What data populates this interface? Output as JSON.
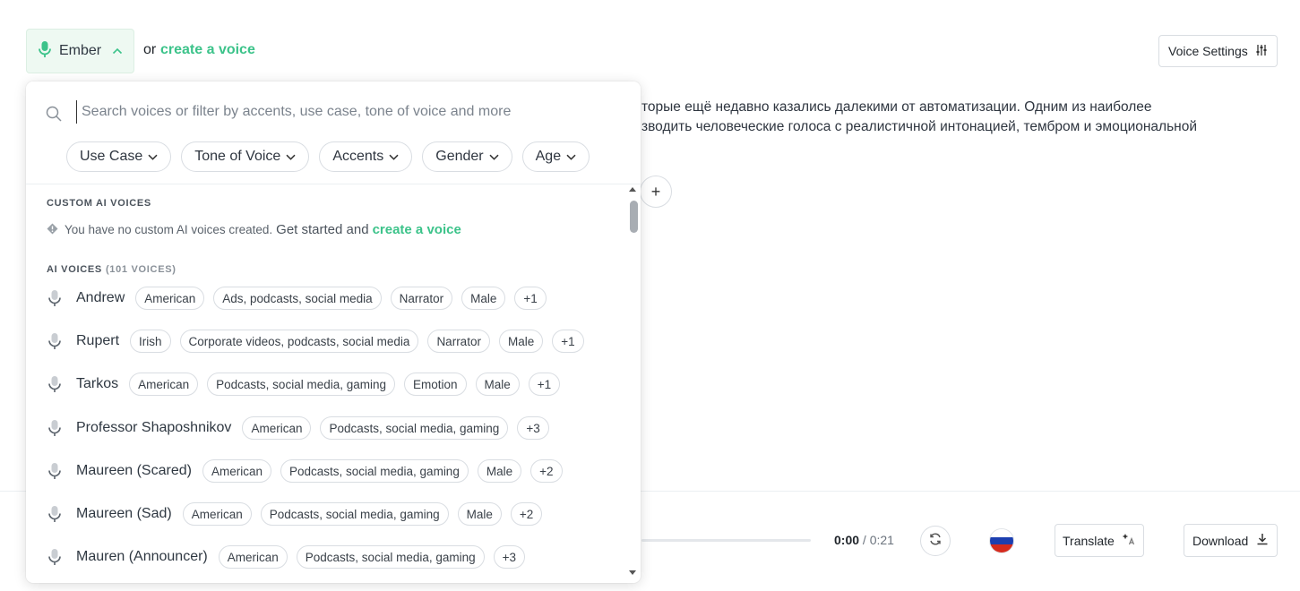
{
  "header": {
    "selected_voice": "Ember",
    "or_text": "or",
    "create_voice_link": "create a voice",
    "voice_settings_label": "Voice Settings"
  },
  "editor": {
    "line1": "торые ещё недавно казались далекими от автоматизации. Одним из наиболее",
    "line2": "зводить человеческие голоса с реалистичной интонацией, тембром и эмоциональной",
    "add_label": "+"
  },
  "player": {
    "current_time": "0:00",
    "separator": " / ",
    "total_time": "0:21",
    "progress": 0,
    "language_flag": "ru",
    "translate_label": "Translate",
    "download_label": "Download"
  },
  "dropdown": {
    "search_placeholder": "Search voices or filter by accents, use case, tone of voice and more",
    "filters": [
      "Use Case",
      "Tone of Voice",
      "Accents",
      "Gender",
      "Age"
    ],
    "custom_section_title": "CUSTOM AI VOICES",
    "custom_note": "You have no custom AI voices created.",
    "custom_lead": "Get started and",
    "custom_link": "create a voice",
    "ai_section_title": "AI VOICES",
    "ai_section_count": "(101 VOICES)",
    "voices": [
      {
        "name": "Andrew",
        "tags": [
          "American",
          "Ads, podcasts, social media",
          "Narrator",
          "Male",
          "+1"
        ]
      },
      {
        "name": "Rupert",
        "tags": [
          "Irish",
          "Corporate videos, podcasts, social media",
          "Narrator",
          "Male",
          "+1"
        ]
      },
      {
        "name": "Tarkos",
        "tags": [
          "American",
          "Podcasts, social media, gaming",
          "Emotion",
          "Male",
          "+1"
        ]
      },
      {
        "name": "Professor Shaposhnikov",
        "tags": [
          "American",
          "Podcasts, social media, gaming",
          "+3"
        ]
      },
      {
        "name": "Maureen (Scared)",
        "tags": [
          "American",
          "Podcasts, social media, gaming",
          "Male",
          "+2"
        ]
      },
      {
        "name": "Maureen (Sad)",
        "tags": [
          "American",
          "Podcasts, social media, gaming",
          "Male",
          "+2"
        ]
      },
      {
        "name": "Mauren (Announcer)",
        "tags": [
          "American",
          "Podcasts, social media, gaming",
          "+3"
        ]
      }
    ]
  },
  "colors": {
    "accent": "#3cc38a",
    "selected_bg": "#eef9f2"
  }
}
